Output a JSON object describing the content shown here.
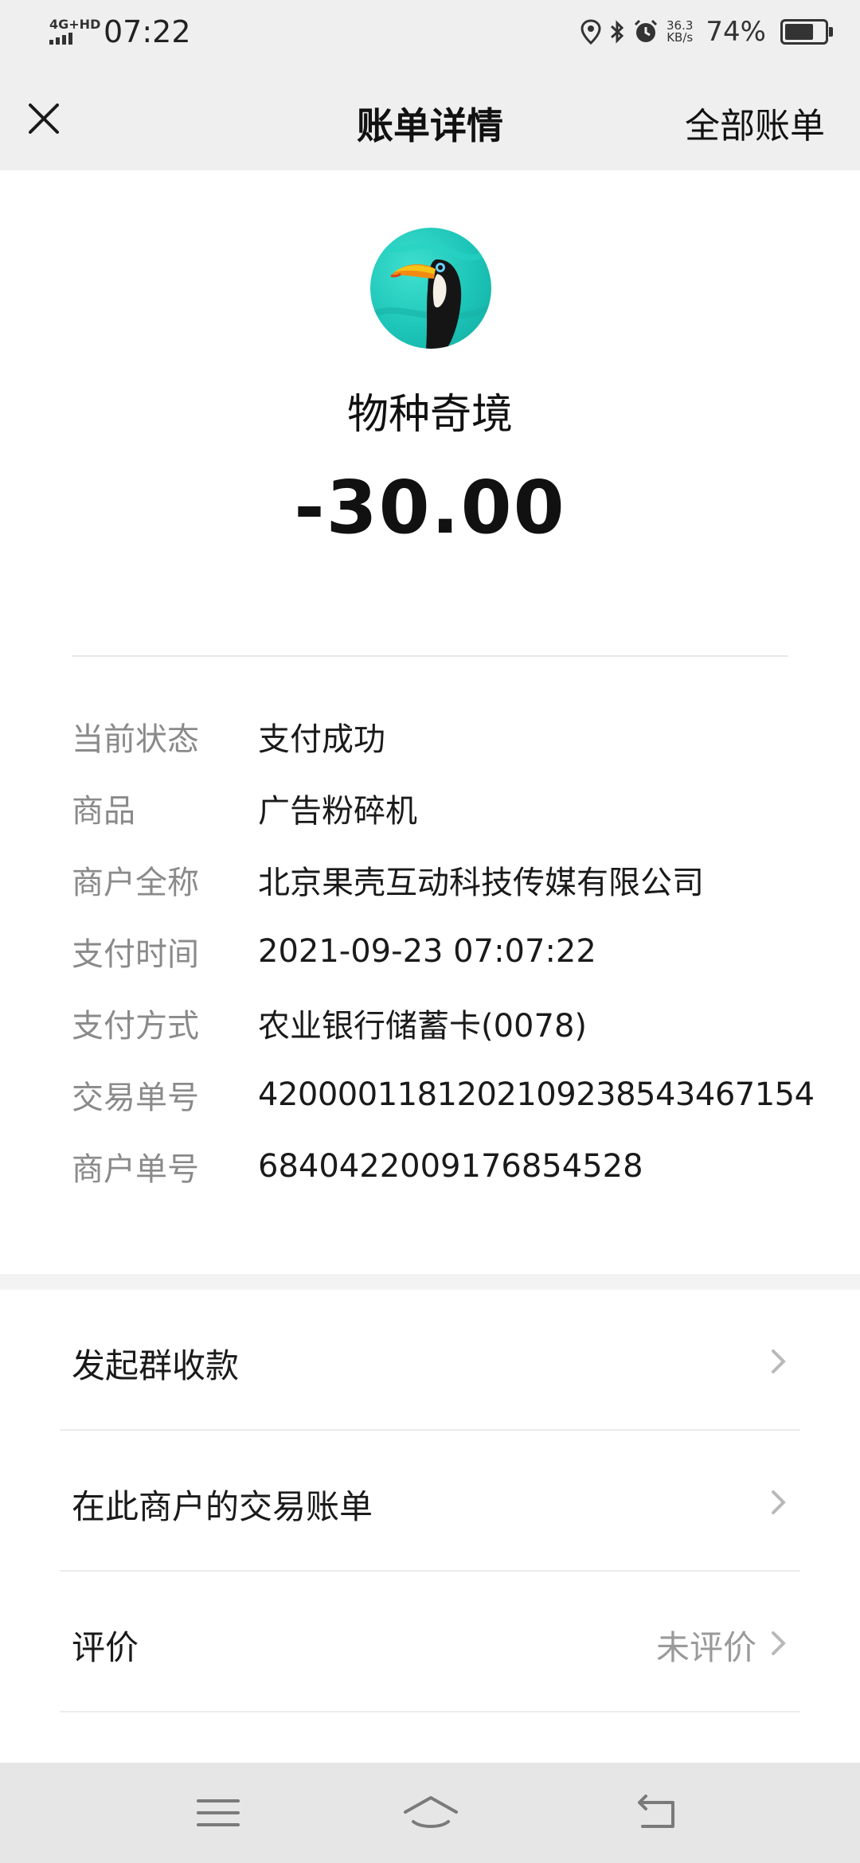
{
  "status_bar": {
    "network": "4G+HD",
    "time": "07:22",
    "speed_value": "36.3",
    "speed_unit": "KB/s",
    "battery": "74%",
    "battery_level": 0.74
  },
  "nav": {
    "title": "账单详情",
    "right_action": "全部账单"
  },
  "merchant": {
    "name": "物种奇境",
    "amount": "-30.00"
  },
  "details": [
    {
      "label": "当前状态",
      "value": "支付成功"
    },
    {
      "label": "商品",
      "value": "广告粉碎机"
    },
    {
      "label": "商户全称",
      "value": "北京果壳互动科技传媒有限公司"
    },
    {
      "label": "支付时间",
      "value": "2021-09-23 07:07:22"
    },
    {
      "label": "支付方式",
      "value": "农业银行储蓄卡(0078)"
    },
    {
      "label": "交易单号",
      "value": "4200001181202109238543467154"
    },
    {
      "label": "商户单号",
      "value": "6840422009176854528"
    }
  ],
  "actions": [
    {
      "label": "发起群收款",
      "extra": ""
    },
    {
      "label": "在此商户的交易账单",
      "extra": ""
    },
    {
      "label": "评价",
      "extra": "未评价"
    }
  ],
  "colors": {
    "avatar_teal": "#1cc5b8",
    "bar_background": "#efefef"
  },
  "icons": {
    "close": "close-icon",
    "chevron": "chevron-right-icon",
    "menu": "menu-icon",
    "home": "home-icon",
    "back": "back-icon"
  }
}
